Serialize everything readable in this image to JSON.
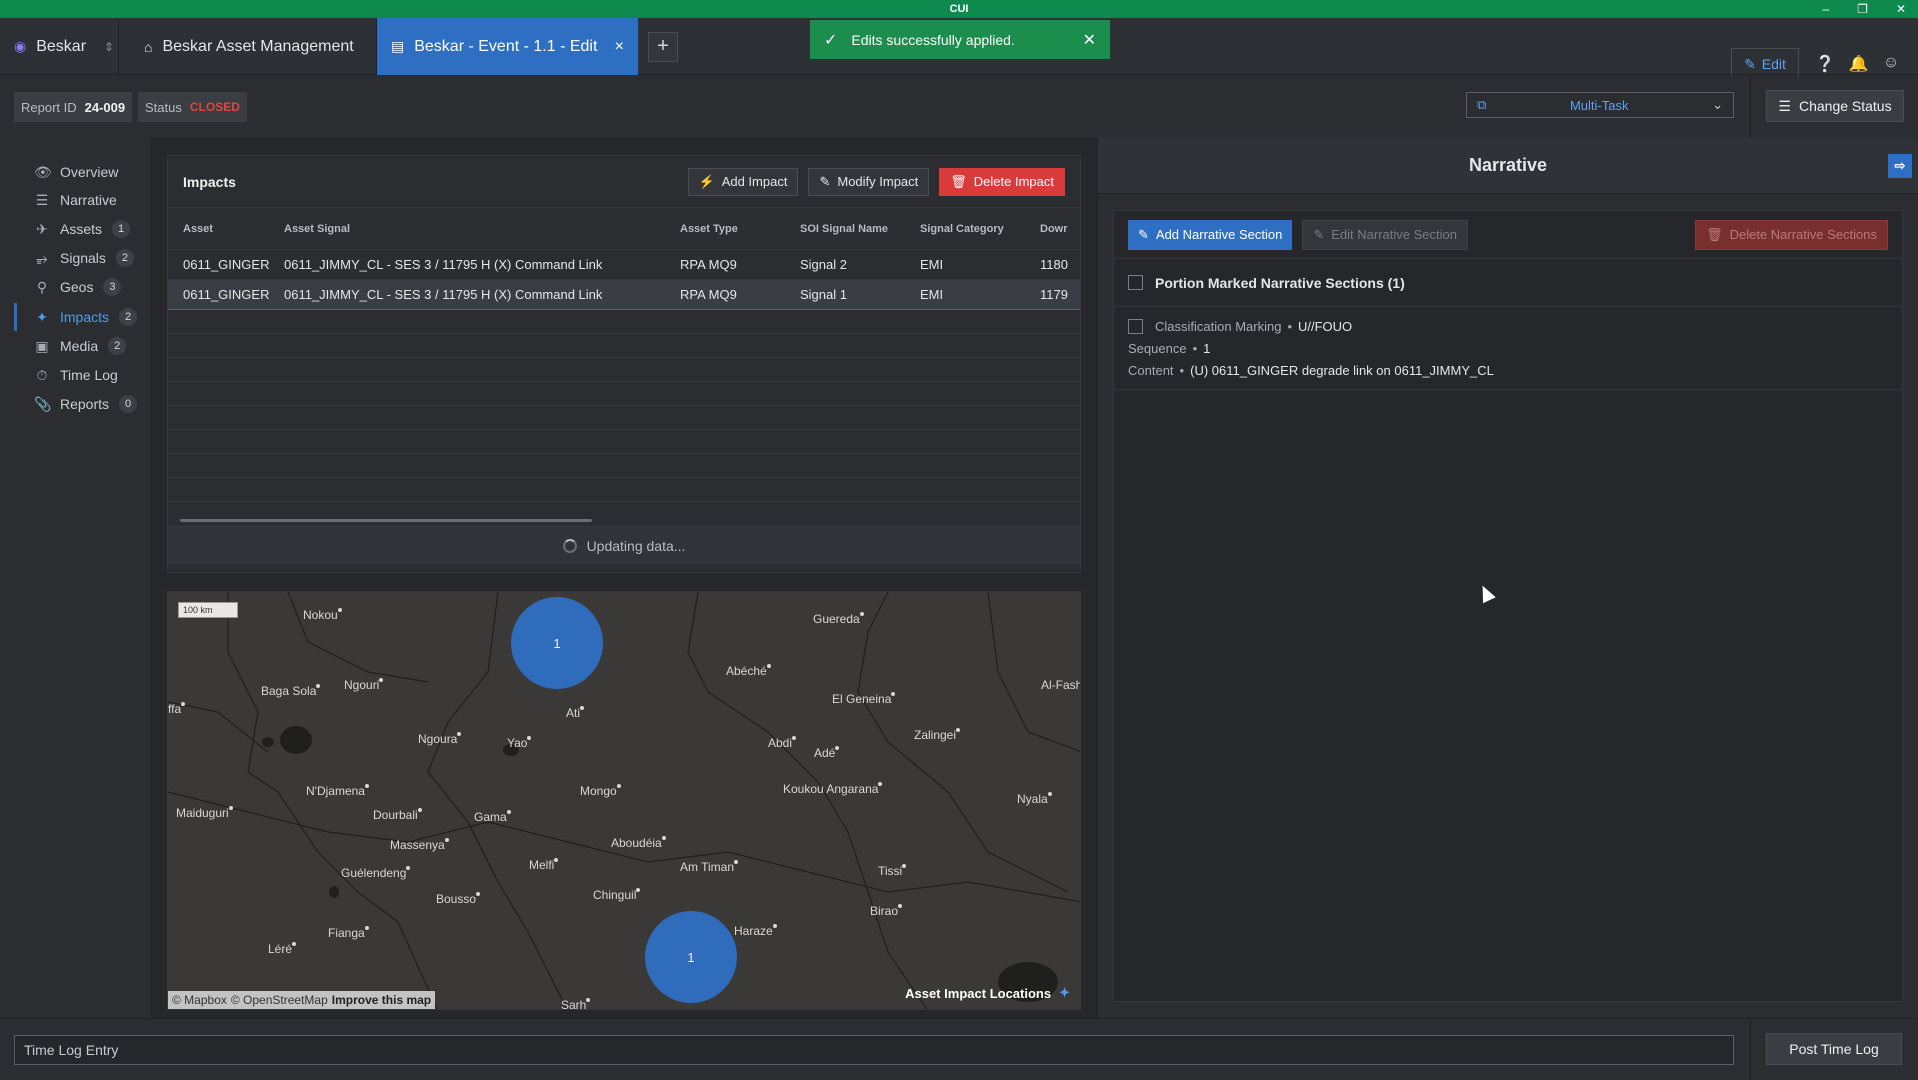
{
  "app": {
    "banner": "CUI",
    "logo": "Beskar"
  },
  "window_controls": [
    "–",
    "❐",
    "✕"
  ],
  "tabs": [
    {
      "label": "Beskar Asset Management",
      "icon": "home-icon"
    },
    {
      "label": "Beskar - Event - 1.1 - Edit",
      "icon": "document-icon",
      "close": "×"
    }
  ],
  "new_tab": "+",
  "toast": {
    "message": "Edits successfully applied.",
    "close": "✕"
  },
  "edit_button": "Edit",
  "ellipsis": "•••",
  "report": {
    "id_label": "Report ID",
    "id_value": "24-009",
    "status_label": "Status",
    "status_value": "CLOSED"
  },
  "multitask": {
    "label": "Multi-Task"
  },
  "change_status": "Change Status",
  "sidebar": {
    "items": [
      {
        "label": "Overview",
        "icon": "eye-icon",
        "badge": ""
      },
      {
        "label": "Narrative",
        "icon": "lines-icon",
        "badge": ""
      },
      {
        "label": "Assets",
        "icon": "plane-icon",
        "badge": "1"
      },
      {
        "label": "Signals",
        "icon": "rss-icon",
        "badge": "2"
      },
      {
        "label": "Geos",
        "icon": "map-pin-icon",
        "badge": "3"
      },
      {
        "label": "Impacts",
        "icon": "impact-icon",
        "badge": "2"
      },
      {
        "label": "Media",
        "icon": "image-icon",
        "badge": "2"
      },
      {
        "label": "Time Log",
        "icon": "stopwatch-icon",
        "badge": ""
      },
      {
        "label": "Reports",
        "icon": "paperclip-icon",
        "badge": "0"
      }
    ]
  },
  "impacts": {
    "title": "Impacts",
    "add": "Add Impact",
    "modify": "Modify Impact",
    "delete": "Delete Impact",
    "columns": [
      "Asset",
      "Asset Signal",
      "Asset Type",
      "SOI Signal Name",
      "Signal Category",
      "Dowr"
    ],
    "rows": [
      [
        "0611_GINGER",
        "0611_JIMMY_CL - SES 3 / 11795 H (X) Command Link",
        "RPA MQ9",
        "Signal 2",
        "EMI",
        "1180"
      ],
      [
        "0611_GINGER",
        "0611_JIMMY_CL - SES 3 / 11795 H (X) Command Link",
        "RPA MQ9",
        "Signal 1",
        "EMI",
        "1179"
      ]
    ],
    "updating": "Updating data..."
  },
  "map": {
    "scale": "100 km",
    "clusters": [
      "1",
      "1"
    ],
    "cities": [
      "Nokou",
      "Guereda",
      "Baga Sola",
      "Ngouri",
      "Abéché",
      "Ati",
      "El Geneina",
      "Al-Fash",
      "Ngoura",
      "Yao",
      "Abdi",
      "Adé",
      "Zalingei",
      "Maiduguri",
      "N'Djamena",
      "Mongo",
      "Koukou Angarana",
      "Nyala",
      "Dourbali",
      "Gama",
      "Massenya",
      "Aboudéia",
      "Guélendeng",
      "Melfi",
      "Am Timan",
      "Tissi",
      "Bousso",
      "Chinguil",
      "Birao",
      "Fianga",
      "Haraze",
      "Léré",
      "Sarh",
      "ffa"
    ],
    "attribution": [
      "© Mapbox",
      "© OpenStreetMap",
      "Improve this map"
    ],
    "legend": "Asset Impact Locations"
  },
  "narrative": {
    "title": "Narrative",
    "add": "Add Narrative Section",
    "edit": "Edit Narrative Section",
    "delete": "Delete Narrative Sections",
    "section_header": "Portion Marked Narrative Sections (1)",
    "classification_label": "Classification Marking",
    "classification_value": "U//FOUO",
    "sequence_label": "Sequence",
    "sequence_value": "1",
    "content_label": "Content",
    "content_value": "(U) 0611_GINGER degrade link on 0611_JIMMY_CL"
  },
  "timelog": {
    "placeholder": "Time Log Entry",
    "post": "Post Time Log"
  }
}
